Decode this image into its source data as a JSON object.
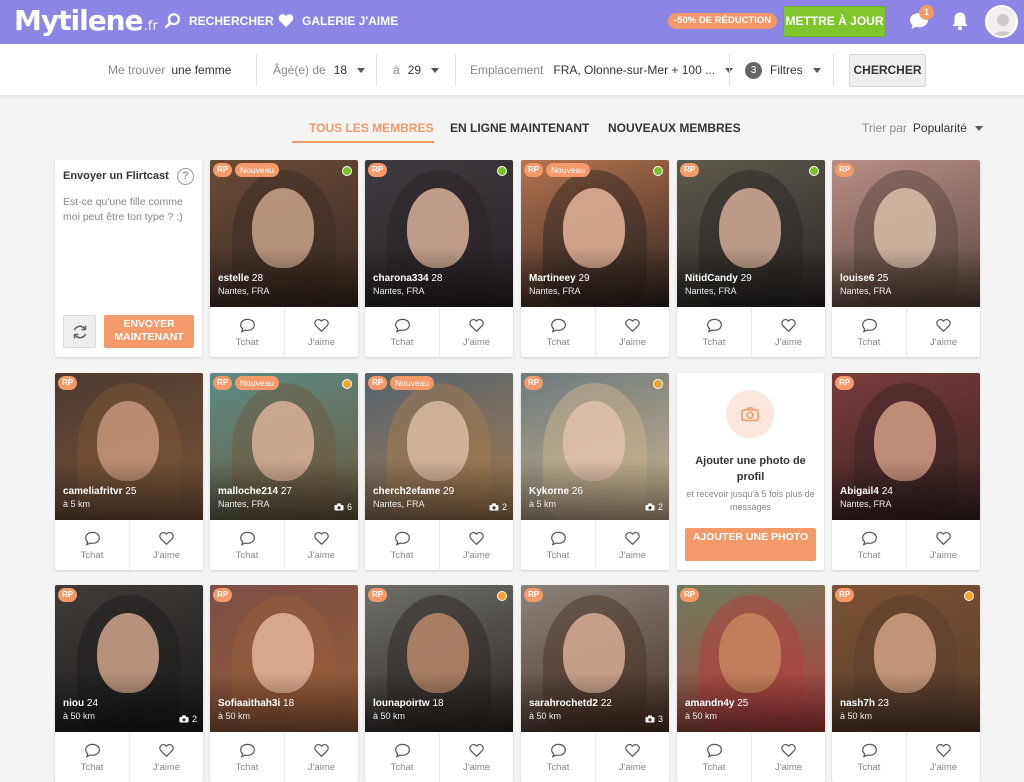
{
  "header": {
    "logo_main": "Mytilene",
    "logo_tld": ".fr",
    "search_label": "RECHERCHER",
    "gallery_label": "GALERIE J'AIME",
    "promo": "-50% DE RÉDUCTION",
    "upgrade_label": "METTRE À JOUR",
    "messages_badge": "1",
    "icons": [
      "search-icon",
      "heart-icon",
      "chat-icon",
      "bell-icon"
    ]
  },
  "search": {
    "find_label": "Me trouver",
    "find_value": "une femme",
    "age_label": "Âgé(e) de",
    "age_min": "18",
    "age_to": "à",
    "age_max": "29",
    "location_label": "Emplacement",
    "location_value": "FRA, Olonne-sur-Mer + 100 ...",
    "filters_count": "3",
    "filters_label": "Filtres",
    "search_button": "CHERCHER"
  },
  "tabs": {
    "all": "TOUS LES MEMBRES",
    "online": "EN LIGNE MAINTENANT",
    "new": "NOUVEAUX MEMBRES",
    "sort_label": "Trier par",
    "sort_value": "Popularité"
  },
  "flirtcast": {
    "title": "Envoyer un Flirtcast",
    "help": "?",
    "text": "Est-ce qu'une fille comme moi peut être ton type ? :)",
    "send_button": "ENVOYER MAINTENANT"
  },
  "add_photo": {
    "title": "Ajouter une photo de profil",
    "subtitle": "et recevoir jusqu'à 5 fois plus de messages",
    "button": "AJOUTER UNE PHOTO"
  },
  "card_actions": {
    "chat": "Tchat",
    "like": "J'aime"
  },
  "badges": {
    "rp": "RP",
    "new": "Nouveau"
  },
  "colors": {
    "header": "#8c85e6",
    "accent": "#f3996a",
    "upgrade": "#80c42e",
    "online_green": "#7bc02a",
    "online_orange": "#f2a22a"
  },
  "members": [
    {
      "name": "estelle",
      "age": "28",
      "loc": "Nantes, FRA",
      "new": true,
      "status": "green",
      "photos": ""
    },
    {
      "name": "charona334",
      "age": "28",
      "loc": "Nantes, FRA",
      "new": false,
      "status": "green",
      "photos": ""
    },
    {
      "name": "Martineey",
      "age": "29",
      "loc": "Nantes, FRA",
      "new": true,
      "status": "green",
      "photos": ""
    },
    {
      "name": "NitidCandy",
      "age": "29",
      "loc": "Nantes, FRA",
      "new": false,
      "status": "green",
      "photos": ""
    },
    {
      "name": "louise6",
      "age": "25",
      "loc": "Nantes, FRA",
      "new": false,
      "status": "",
      "photos": ""
    },
    {
      "name": "cameliafritvr",
      "age": "25",
      "loc": "à 5 km",
      "new": false,
      "status": "",
      "photos": ""
    },
    {
      "name": "malloche214",
      "age": "27",
      "loc": "Nantes, FRA",
      "new": true,
      "status": "orange",
      "photos": "6"
    },
    {
      "name": "cherch2efame",
      "age": "29",
      "loc": "Nantes, FRA",
      "new": true,
      "status": "",
      "photos": "2"
    },
    {
      "name": "Kykorne",
      "age": "26",
      "loc": "à 5 km",
      "new": false,
      "status": "orange",
      "photos": "2"
    },
    {
      "name": "Abigail4",
      "age": "24",
      "loc": "Nantes, FRA",
      "new": false,
      "status": "",
      "photos": ""
    },
    {
      "name": "niou",
      "age": "24",
      "loc": "à 50 km",
      "new": false,
      "status": "",
      "photos": "2"
    },
    {
      "name": "Sofiaaithah3i",
      "age": "18",
      "loc": "à 50 km",
      "new": false,
      "status": "",
      "photos": ""
    },
    {
      "name": "lounapoirtw",
      "age": "18",
      "loc": "à 50 km",
      "new": false,
      "status": "orange",
      "photos": ""
    },
    {
      "name": "sarahrochetd2",
      "age": "22",
      "loc": "à 50 km",
      "new": false,
      "status": "",
      "photos": "3"
    },
    {
      "name": "amandn4y",
      "age": "25",
      "loc": "à 50 km",
      "new": false,
      "status": "",
      "photos": ""
    },
    {
      "name": "nash7h",
      "age": "23",
      "loc": "à 50 km",
      "new": false,
      "status": "orange",
      "photos": ""
    }
  ]
}
